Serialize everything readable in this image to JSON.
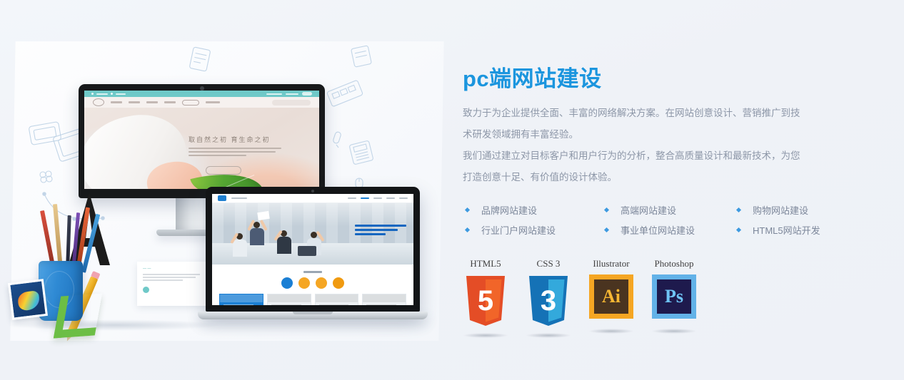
{
  "page": {
    "background_color": "#f0f3f8"
  },
  "panel": {
    "title": "pc端网站建设",
    "title_color": "#1b95de",
    "paragraphs": [
      "致力于为企业提供全面、丰富的网络解决方案。在网站创意设计、营销推广到技",
      "术研发领域拥有丰富经验。",
      "我们通过建立对目标客户和用户行为的分析，整合高质量设计和最新技术，为您",
      "打造创意十足、有价值的设计体验。"
    ],
    "body_color": "#8d97a8",
    "features": [
      "品牌网站建设",
      "高端网站建设",
      "购物网站建设",
      "行业门户网站建设",
      "事业单位网站建设",
      "HTML5网站开发"
    ],
    "bullet_color": "#3d9ae0"
  },
  "badges": [
    {
      "label": "HTML5",
      "glyph": "5",
      "shape": "shield",
      "outer_color": "#e44d26",
      "inner_color": "#f16529",
      "glyph_color": "#ffffff"
    },
    {
      "label": "CSS 3",
      "glyph": "3",
      "shape": "shield",
      "outer_color": "#1572b6",
      "inner_color": "#33a9dc",
      "glyph_color": "#ffffff"
    },
    {
      "label": "Illustrator",
      "glyph": "Ai",
      "shape": "square",
      "outer_color": "#f5a623",
      "inner_color": "#4a3420",
      "glyph_color": "#f7b733"
    },
    {
      "label": "Photoshop",
      "glyph": "Ps",
      "shape": "square",
      "outer_color": "#62b2e8",
      "inner_color": "#1e1a4d",
      "glyph_color": "#6fc4f5"
    }
  ],
  "visual": {
    "monitor": {
      "device": "desktop-monitor",
      "site_headline": "取自然之初  育生命之初",
      "accent_color": "#6fc9c8"
    },
    "laptop": {
      "device": "laptop",
      "accent_color": "#1b7fd4"
    },
    "supplies": [
      "pencil-cup",
      "colored-pencils",
      "triangle-ruler",
      "yellow-pencil",
      "photo-card",
      "letter-a-sculpture"
    ],
    "sketch_icons": [
      "tablet-sketch",
      "monitor-sketch",
      "flower-sketch",
      "bezier-curve-sketch",
      "keyboard-sketch",
      "calculator-sketch",
      "mouse-sketch",
      "pen-sketch"
    ],
    "sketch_color": "#b9cfe4"
  }
}
